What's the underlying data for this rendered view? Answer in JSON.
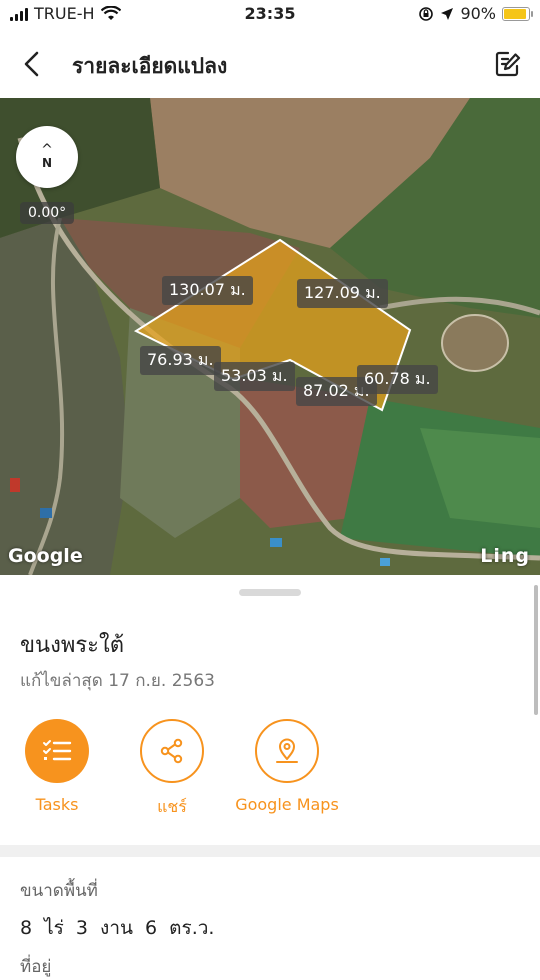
{
  "status_bar": {
    "carrier": "TRUE-H",
    "time": "23:35",
    "battery": "90%",
    "battery_level": 0.9
  },
  "header": {
    "title": "รายละเอียดแปลง",
    "back_icon": "chevron-left-icon",
    "edit_icon": "edit-note-icon"
  },
  "map": {
    "compass_label": "N",
    "heading": "0.00°",
    "dimensions": [
      "130.07 ม.",
      "127.09 ม.",
      "76.93 ม.",
      "53.03 ม.",
      "87.02 ม.",
      "60.78 ม."
    ],
    "provider_logo": "Google",
    "app_watermark": "Ling",
    "plot_color": "#e8a21a"
  },
  "plot": {
    "name": "ขนงพระใต้",
    "updated": "แก้ไขล่าสุด 17 ก.ย. 2563"
  },
  "actions": [
    {
      "label": "Tasks",
      "icon": "tasks-icon"
    },
    {
      "label": "แชร์",
      "icon": "share-icon"
    },
    {
      "label": "Google Maps",
      "icon": "map-pin-icon"
    }
  ],
  "area": {
    "title": "ขนาดพื้นที่",
    "value": "8 ไร่  3 งาน  6 ตร.ว.",
    "next_label": "ที่อยู่"
  },
  "colors": {
    "accent": "#f7931e"
  }
}
